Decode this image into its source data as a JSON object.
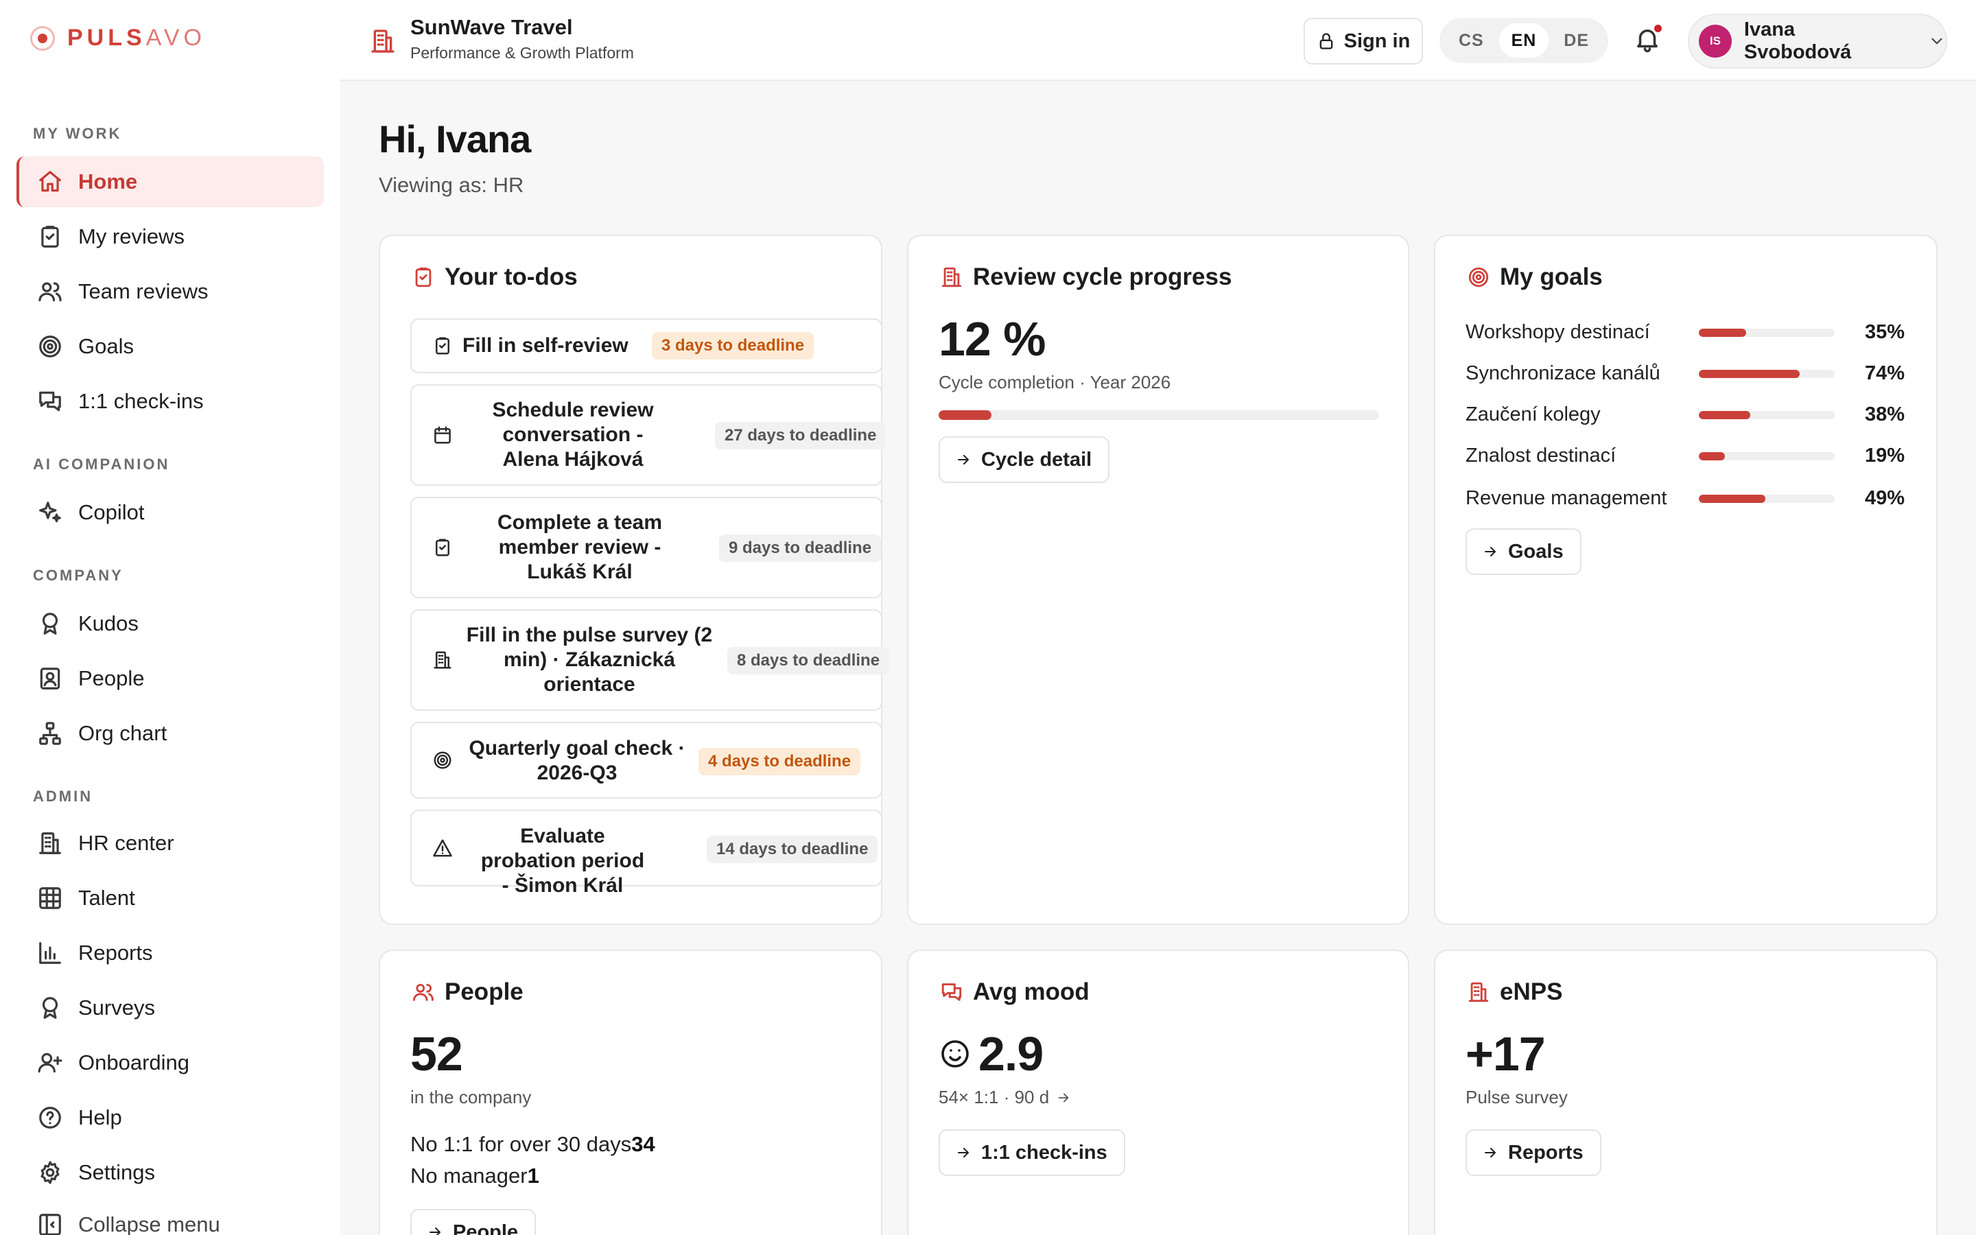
{
  "brand": {
    "part1": "PULS",
    "part2": "AVO"
  },
  "sidebar": {
    "sections": {
      "my_work": "MY WORK",
      "ai": "AI COMPANION",
      "company": "COMPANY",
      "admin": "ADMIN"
    },
    "items": {
      "home": "Home",
      "my_reviews": "My reviews",
      "team_reviews": "Team reviews",
      "goals": "Goals",
      "checkins": "1:1 check-ins",
      "copilot": "Copilot",
      "kudos": "Kudos",
      "people": "People",
      "org_chart": "Org chart",
      "hr_center": "HR center",
      "talent": "Talent",
      "reports": "Reports",
      "surveys": "Surveys",
      "onboarding": "Onboarding",
      "help": "Help",
      "settings": "Settings",
      "collapse": "Collapse menu"
    }
  },
  "header": {
    "org_title": "SunWave Travel",
    "org_subtitle": "Performance & Growth Platform",
    "sign_in": "Sign in",
    "languages": [
      "CS",
      "EN",
      "DE"
    ],
    "active_language": "EN",
    "user_initials": "IS",
    "user_name": "Ivana Svobodová"
  },
  "main": {
    "greeting": "Hi, Ivana",
    "viewing_as": "Viewing as: HR"
  },
  "todos": {
    "title": "Your to-dos",
    "items": [
      {
        "label": "Fill in self-review",
        "deadline": "3 days to deadline",
        "status": "warn"
      },
      {
        "label": "Schedule review conversation - Alena Hájková",
        "deadline": "27 days to deadline",
        "status": "neutral"
      },
      {
        "label": "Complete a team member review - Lukáš Král",
        "deadline": "9 days to deadline",
        "status": "neutral"
      },
      {
        "label": "Fill in the pulse survey (2 min) · Zákaznická orientace",
        "deadline": "8 days to deadline",
        "status": "neutral"
      },
      {
        "label": "Quarterly goal check · 2026-Q3",
        "deadline": "4 days to deadline",
        "status": "warn"
      },
      {
        "label": "Evaluate probation period - Šimon Král",
        "deadline": "14 days to deadline",
        "status": "neutral"
      }
    ]
  },
  "review_cycle": {
    "title": "Review cycle progress",
    "percent_label": "12 %",
    "progress": 0.12,
    "caption": "Cycle completion · Year 2026",
    "button": "Cycle detail"
  },
  "goals_card": {
    "title": "My goals",
    "goals": [
      {
        "name": "Workshopy destinací",
        "pct_label": "35%",
        "progress": 0.35
      },
      {
        "name": "Synchronizace kanálů",
        "pct_label": "74%",
        "progress": 0.74
      },
      {
        "name": "Zaučení kolegy",
        "pct_label": "38%",
        "progress": 0.38
      },
      {
        "name": "Znalost destinací",
        "pct_label": "19%",
        "progress": 0.19
      },
      {
        "name": "Revenue management",
        "pct_label": "49%",
        "progress": 0.49
      }
    ],
    "button": "Goals"
  },
  "people_card": {
    "title": "People",
    "count": "52",
    "caption": "in the company",
    "no_checkin_label": "No 1:1 for over 30 days",
    "no_checkin_value": "34",
    "no_manager_label": "No manager",
    "no_manager_value": "1",
    "button": "People"
  },
  "mood_card": {
    "title": "Avg mood",
    "value": "2.9",
    "caption": "54× 1:1 · 90 d",
    "button": "1:1 check-ins"
  },
  "enps_card": {
    "title": "eNPS",
    "value": "+17",
    "caption": "Pulse survey",
    "button": "Reports"
  },
  "colors": {
    "accent": "#d0413a",
    "warn_bg": "#fdebd7",
    "warn_fg": "#c2560c"
  },
  "icons": [
    "home-icon",
    "clipboard-icon",
    "users-icon",
    "target-icon",
    "chat-icon",
    "sparkles-icon",
    "award-icon",
    "contact-icon",
    "org-chart-icon",
    "building-icon",
    "grid-icon",
    "bar-chart-icon",
    "user-plus-icon",
    "help-icon",
    "gear-icon",
    "lock-icon",
    "bell-icon",
    "chevron-down-icon",
    "calendar-icon",
    "alert-icon",
    "arrow-right-icon",
    "smiley-icon",
    "panel-icon"
  ]
}
